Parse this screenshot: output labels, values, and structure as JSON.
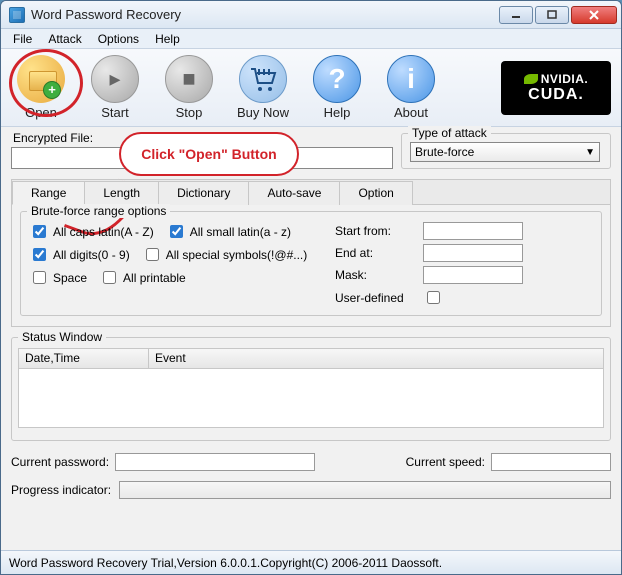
{
  "window": {
    "title": "Word Password Recovery"
  },
  "menu": [
    "File",
    "Attack",
    "Options",
    "Help"
  ],
  "toolbar": {
    "open": "Open",
    "start": "Start",
    "stop": "Stop",
    "buy": "Buy Now",
    "help": "Help",
    "about": "About"
  },
  "nvidia": {
    "top": "NVIDIA.",
    "bottom": "CUDA."
  },
  "callout": "Click \"Open\" Button",
  "file_group": {
    "label": "Encrypted File:",
    "value": ""
  },
  "attack_group": {
    "legend": "Type of attack",
    "selected": "Brute-force"
  },
  "tabs": [
    "Range",
    "Length",
    "Dictionary",
    "Auto-save",
    "Option"
  ],
  "range": {
    "legend": "Brute-force range options",
    "opts": {
      "caps": {
        "label": "All caps latin(A - Z)",
        "checked": true
      },
      "small": {
        "label": "All small latin(a - z)",
        "checked": true
      },
      "digits": {
        "label": "All digits(0 - 9)",
        "checked": true
      },
      "symbols": {
        "label": "All special symbols(!@#...)",
        "checked": false
      },
      "space": {
        "label": "Space",
        "checked": false
      },
      "printable": {
        "label": "All printable",
        "checked": false
      }
    },
    "right": {
      "start": {
        "label": "Start from:",
        "value": ""
      },
      "end": {
        "label": "End at:",
        "value": ""
      },
      "mask": {
        "label": "Mask:",
        "value": ""
      },
      "user": {
        "label": "User-defined",
        "checked": false
      }
    }
  },
  "status": {
    "legend": "Status Window",
    "cols": [
      "Date,Time",
      "Event"
    ]
  },
  "footer": {
    "cur_pw_label": "Current password:",
    "cur_pw": "",
    "cur_sp_label": "Current speed:",
    "cur_sp": "",
    "prog_label": "Progress indicator:"
  },
  "statusbar": "Word Password Recovery Trial,Version 6.0.0.1.Copyright(C) 2006-2011 Daossoft."
}
